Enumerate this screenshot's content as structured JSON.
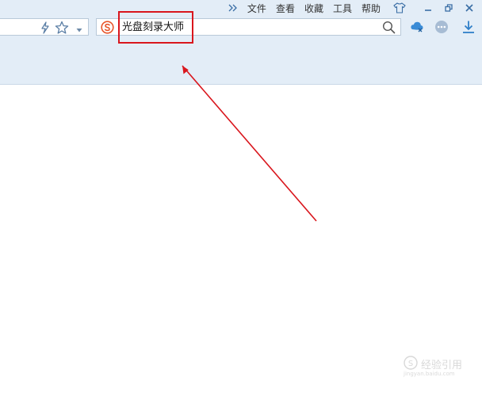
{
  "menu": {
    "items": [
      "文件",
      "查看",
      "收藏",
      "工具",
      "帮助"
    ]
  },
  "toolbar": {
    "left_icons": [
      "lightning-icon",
      "star-icon",
      "chevron-down-icon"
    ],
    "right_icons": [
      "cloud-sync-icon",
      "more-icon",
      "download-icon"
    ]
  },
  "search": {
    "engine_icon": "sogou-icon",
    "value": "光盘刻录大师",
    "action_icon": "search-icon"
  },
  "window_controls": [
    "skin-icon",
    "minimize-icon",
    "restore-icon",
    "close-icon"
  ],
  "annotation": {
    "color": "#d9161d"
  },
  "watermark": {
    "text": "经验引用",
    "sub": "jingyan.baidu.com"
  },
  "colors": {
    "chrome_bg": "#e3edf7",
    "accent_blue": "#3a8bd6",
    "annotation_red": "#d9161d"
  }
}
